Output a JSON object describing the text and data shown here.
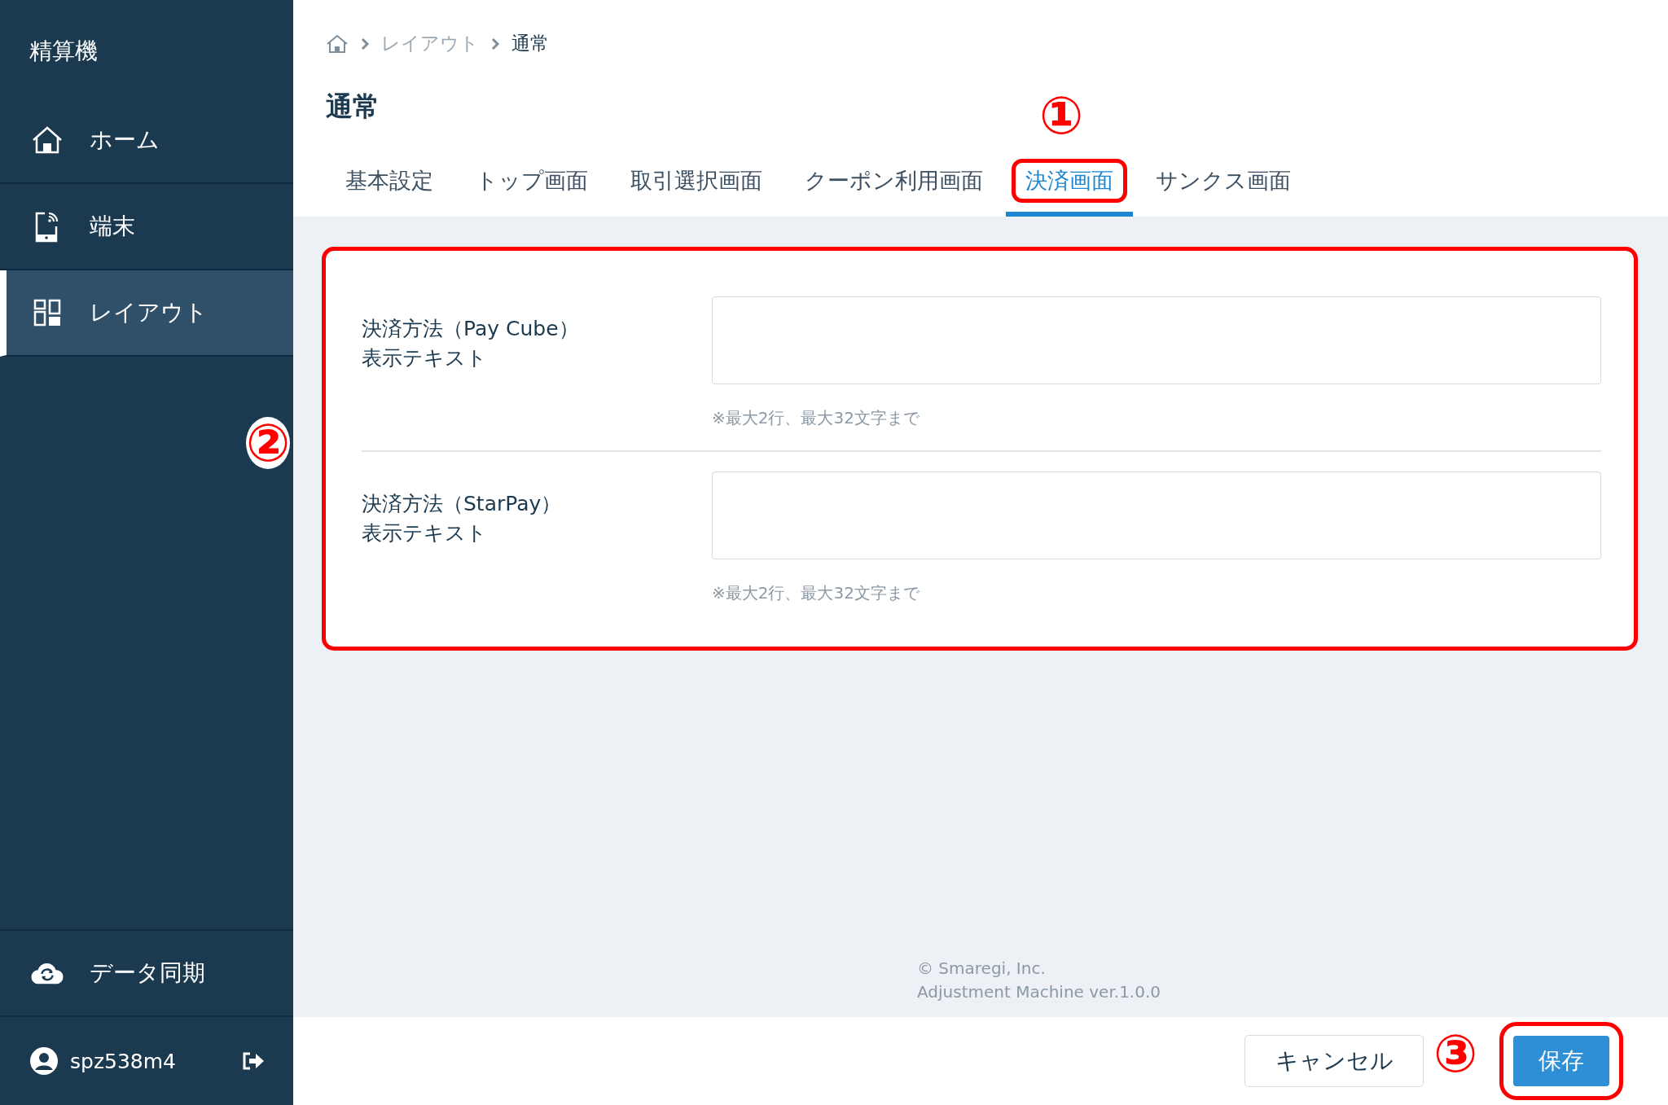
{
  "sidebar": {
    "title": "精算機",
    "items": [
      {
        "label": "ホーム",
        "selected": false
      },
      {
        "label": "端末",
        "selected": false
      },
      {
        "label": "レイアウト",
        "selected": true
      }
    ],
    "sync": {
      "label": "データ同期"
    },
    "user": {
      "name": "spz538m4"
    }
  },
  "breadcrumb": [
    "レイアウト",
    "通常"
  ],
  "page_title": "通常",
  "tabs": [
    {
      "label": "基本設定",
      "selected": false,
      "highlighted": false
    },
    {
      "label": "トップ画面",
      "selected": false,
      "highlighted": false
    },
    {
      "label": "取引選択画面",
      "selected": false,
      "highlighted": false
    },
    {
      "label": "クーポン利用画面",
      "selected": false,
      "highlighted": false
    },
    {
      "label": "決済画面",
      "selected": true,
      "highlighted": true
    },
    {
      "label": "サンクス画面",
      "selected": false,
      "highlighted": false
    }
  ],
  "form": {
    "highlighted": true,
    "fields": [
      {
        "label_lines": [
          "決済方法（Pay Cube）",
          "表示テキスト"
        ],
        "hint": "※最大2行、最大32文字まで"
      },
      {
        "label_lines": [
          "決済方法（StarPay）",
          "表示テキスト"
        ],
        "hint": "※最大2行、最大32文字まで"
      }
    ]
  },
  "footer": {
    "copyright": "© Smaregi, Inc.",
    "version": "Adjustment Machine ver.1.0.0"
  },
  "buttons": {
    "cancel": {
      "label": "キャンセル",
      "highlighted": false
    },
    "save": {
      "label": "保存",
      "highlighted": true
    }
  },
  "annotations": [
    "①",
    "②",
    "③"
  ]
}
